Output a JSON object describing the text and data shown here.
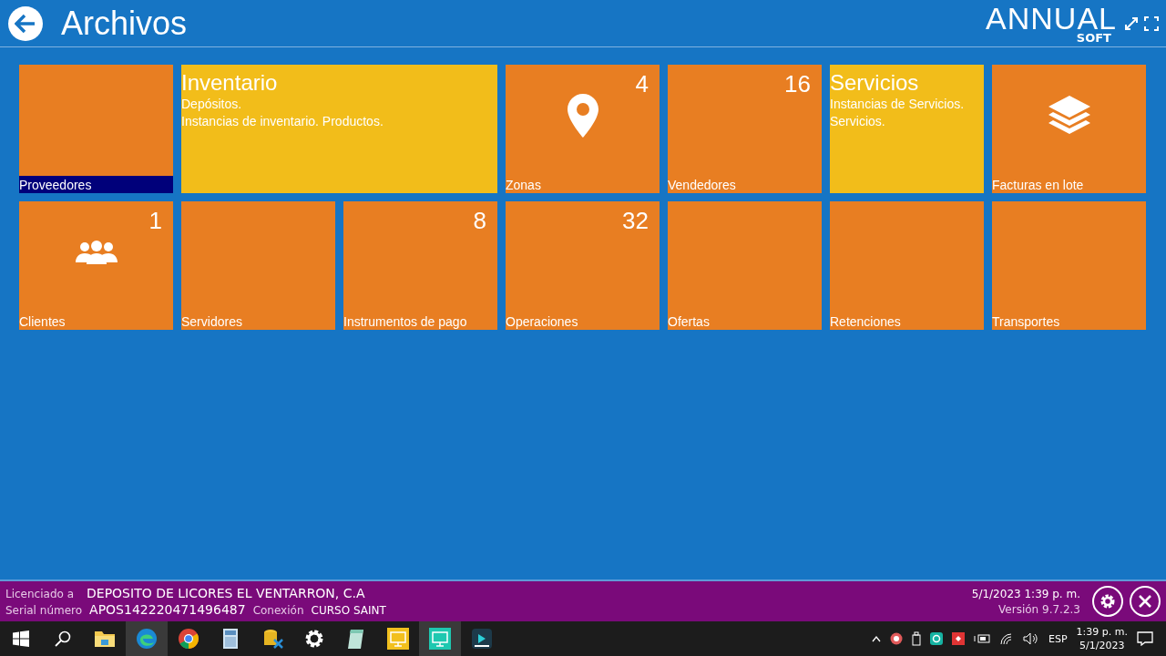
{
  "header": {
    "title": "Archivos",
    "logo": {
      "word": "ANNUAL",
      "sub": "SOFT"
    }
  },
  "tiles": [
    {
      "kind": "plain",
      "label": "Proveedores",
      "selected": true
    },
    {
      "kind": "wide-info",
      "title": "Inventario",
      "lines": [
        "Depósitos.",
        "Instancias de inventario. Productos."
      ],
      "selected": false
    },
    {
      "kind": "location",
      "label": "Zonas",
      "count": "4",
      "selected": false
    },
    {
      "kind": "plain",
      "label": "Vendedores",
      "count": "16",
      "selected": false
    },
    {
      "kind": "info",
      "title": "Servicios",
      "lines": [
        "Instancias de Servicios.",
        "Servicios."
      ],
      "selected": false
    },
    {
      "kind": "stack",
      "label": "Facturas en lote",
      "selected": false
    },
    {
      "kind": "users",
      "label": "Clientes",
      "count": "1",
      "selected": false
    },
    {
      "kind": "plain",
      "label": "Servidores",
      "selected": false
    },
    {
      "kind": "plain",
      "label": "Instrumentos de pago",
      "count": "8",
      "selected": false
    },
    {
      "kind": "plain",
      "label": "Operaciones",
      "count": "32",
      "selected": false
    },
    {
      "kind": "plain",
      "label": "Ofertas",
      "selected": false
    },
    {
      "kind": "plain",
      "label": "Retenciones",
      "selected": false
    },
    {
      "kind": "plain",
      "label": "Transportes",
      "selected": false
    }
  ],
  "footer": {
    "licensed_label": "Licenciado a",
    "licensee": "DEPOSITO DE LICORES EL VENTARRON, C.A",
    "serial_label": "Serial número",
    "serial": "APOS142220471496487",
    "connection_label": "Conexión",
    "connection": "CURSO SAINT",
    "datetime": "5/1/2023 1:39 p. m.",
    "version": "Versión 9.7.2.3"
  },
  "taskbar": {
    "apps": [
      {
        "kind": "folder",
        "selected": false
      },
      {
        "kind": "edge",
        "selected": true
      },
      {
        "kind": "chrome",
        "selected": false
      },
      {
        "kind": "calculator",
        "selected": false
      },
      {
        "kind": "database",
        "selected": false
      },
      {
        "kind": "gear",
        "selected": false
      },
      {
        "kind": "notepad",
        "selected": false
      },
      {
        "kind": "yellow-app",
        "selected": false
      },
      {
        "kind": "teal-app",
        "selected": true
      },
      {
        "kind": "dark-app",
        "selected": false
      }
    ],
    "language": "ESP",
    "time": "1:39 p. m.",
    "date": "5/1/2023"
  }
}
